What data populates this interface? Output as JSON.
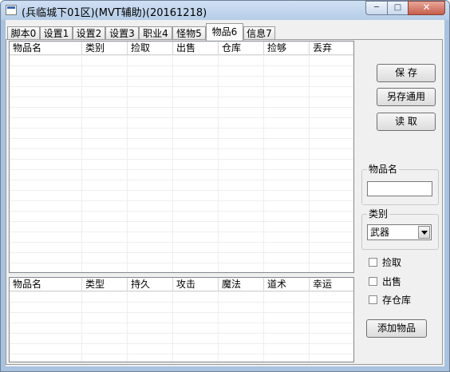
{
  "window": {
    "title": "(兵临城下01区)(MVT辅助)(20161218)",
    "minimize": "─",
    "maximize": "□",
    "close": "✕"
  },
  "tabs": [
    {
      "label": "脚本0"
    },
    {
      "label": "设置1"
    },
    {
      "label": "设置2"
    },
    {
      "label": "设置3"
    },
    {
      "label": "职业4"
    },
    {
      "label": "怪物5"
    },
    {
      "label": "物品6",
      "active": true
    },
    {
      "label": "信息7"
    }
  ],
  "items_table": {
    "columns": [
      "物品名",
      "类别",
      "捡取",
      "出售",
      "仓库",
      "捡够",
      "丢弃"
    ],
    "rows": []
  },
  "stats_table": {
    "columns": [
      "物品名",
      "类型",
      "持久",
      "攻击",
      "魔法",
      "道术",
      "幸运"
    ],
    "rows": []
  },
  "buttons": {
    "save": "保 存",
    "save_as_common": "另存通用",
    "load": "读 取",
    "add_item": "添加物品"
  },
  "item_name_group": {
    "label": "物品名",
    "value": ""
  },
  "category_group": {
    "label": "类别",
    "selected": "武器"
  },
  "checkboxes": [
    {
      "label": "捡取",
      "checked": false
    },
    {
      "label": "出售",
      "checked": false
    },
    {
      "label": "存仓库",
      "checked": false
    }
  ]
}
